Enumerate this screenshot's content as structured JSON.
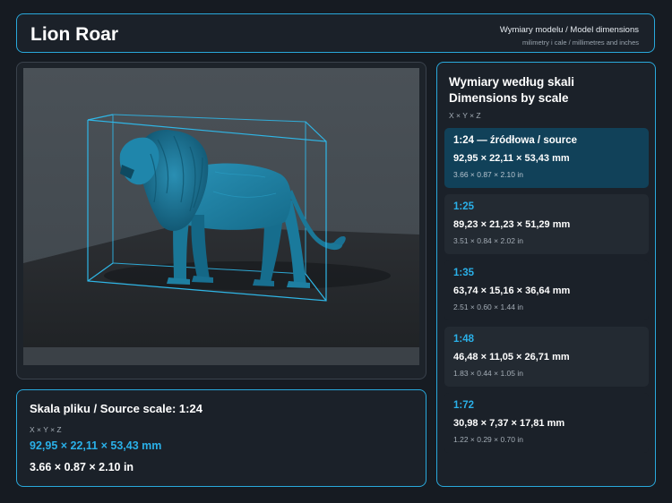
{
  "header": {
    "title": "Lion Roar",
    "subtitle_line1": "Wymiary modelu / Model dimensions",
    "subtitle_line2": "milimetry i cale / millimetres and inches"
  },
  "source": {
    "title": "Skala pliku / Source scale: 1:24",
    "axes": "X × Y × Z",
    "mm": "92,95 × 22,11 × 53,43 mm",
    "inches": "3.66 × 0.87 × 2.10 in"
  },
  "scales": {
    "title_line1": "Wymiary według skali",
    "title_line2": "Dimensions by scale",
    "axes": "X × Y × Z",
    "items": [
      {
        "label": "1:24  —  źródłowa / source",
        "mm": "92,95 × 22,11 × 53,43 mm",
        "inches": "3.66 × 0.87 × 2.10 in"
      },
      {
        "label": "1:25",
        "mm": "89,23 × 21,23 × 51,29 mm",
        "inches": "3.51 × 0.84 × 2.02 in"
      },
      {
        "label": "1:35",
        "mm": "63,74 × 15,16 × 36,64 mm",
        "inches": "2.51 × 0.60 × 1.44 in"
      },
      {
        "label": "1:48",
        "mm": "46,48 × 11,05 × 26,71 mm",
        "inches": "1.83 × 0.44 × 1.05 in"
      },
      {
        "label": "1:72",
        "mm": "30,98 × 7,37 × 17,81 mm",
        "inches": "1.22 × 0.29 × 0.70 in"
      }
    ]
  },
  "colors": {
    "accent": "#29a9dc",
    "model": "#1f7fa0",
    "background": "#161b22",
    "active_card": "#114159"
  }
}
